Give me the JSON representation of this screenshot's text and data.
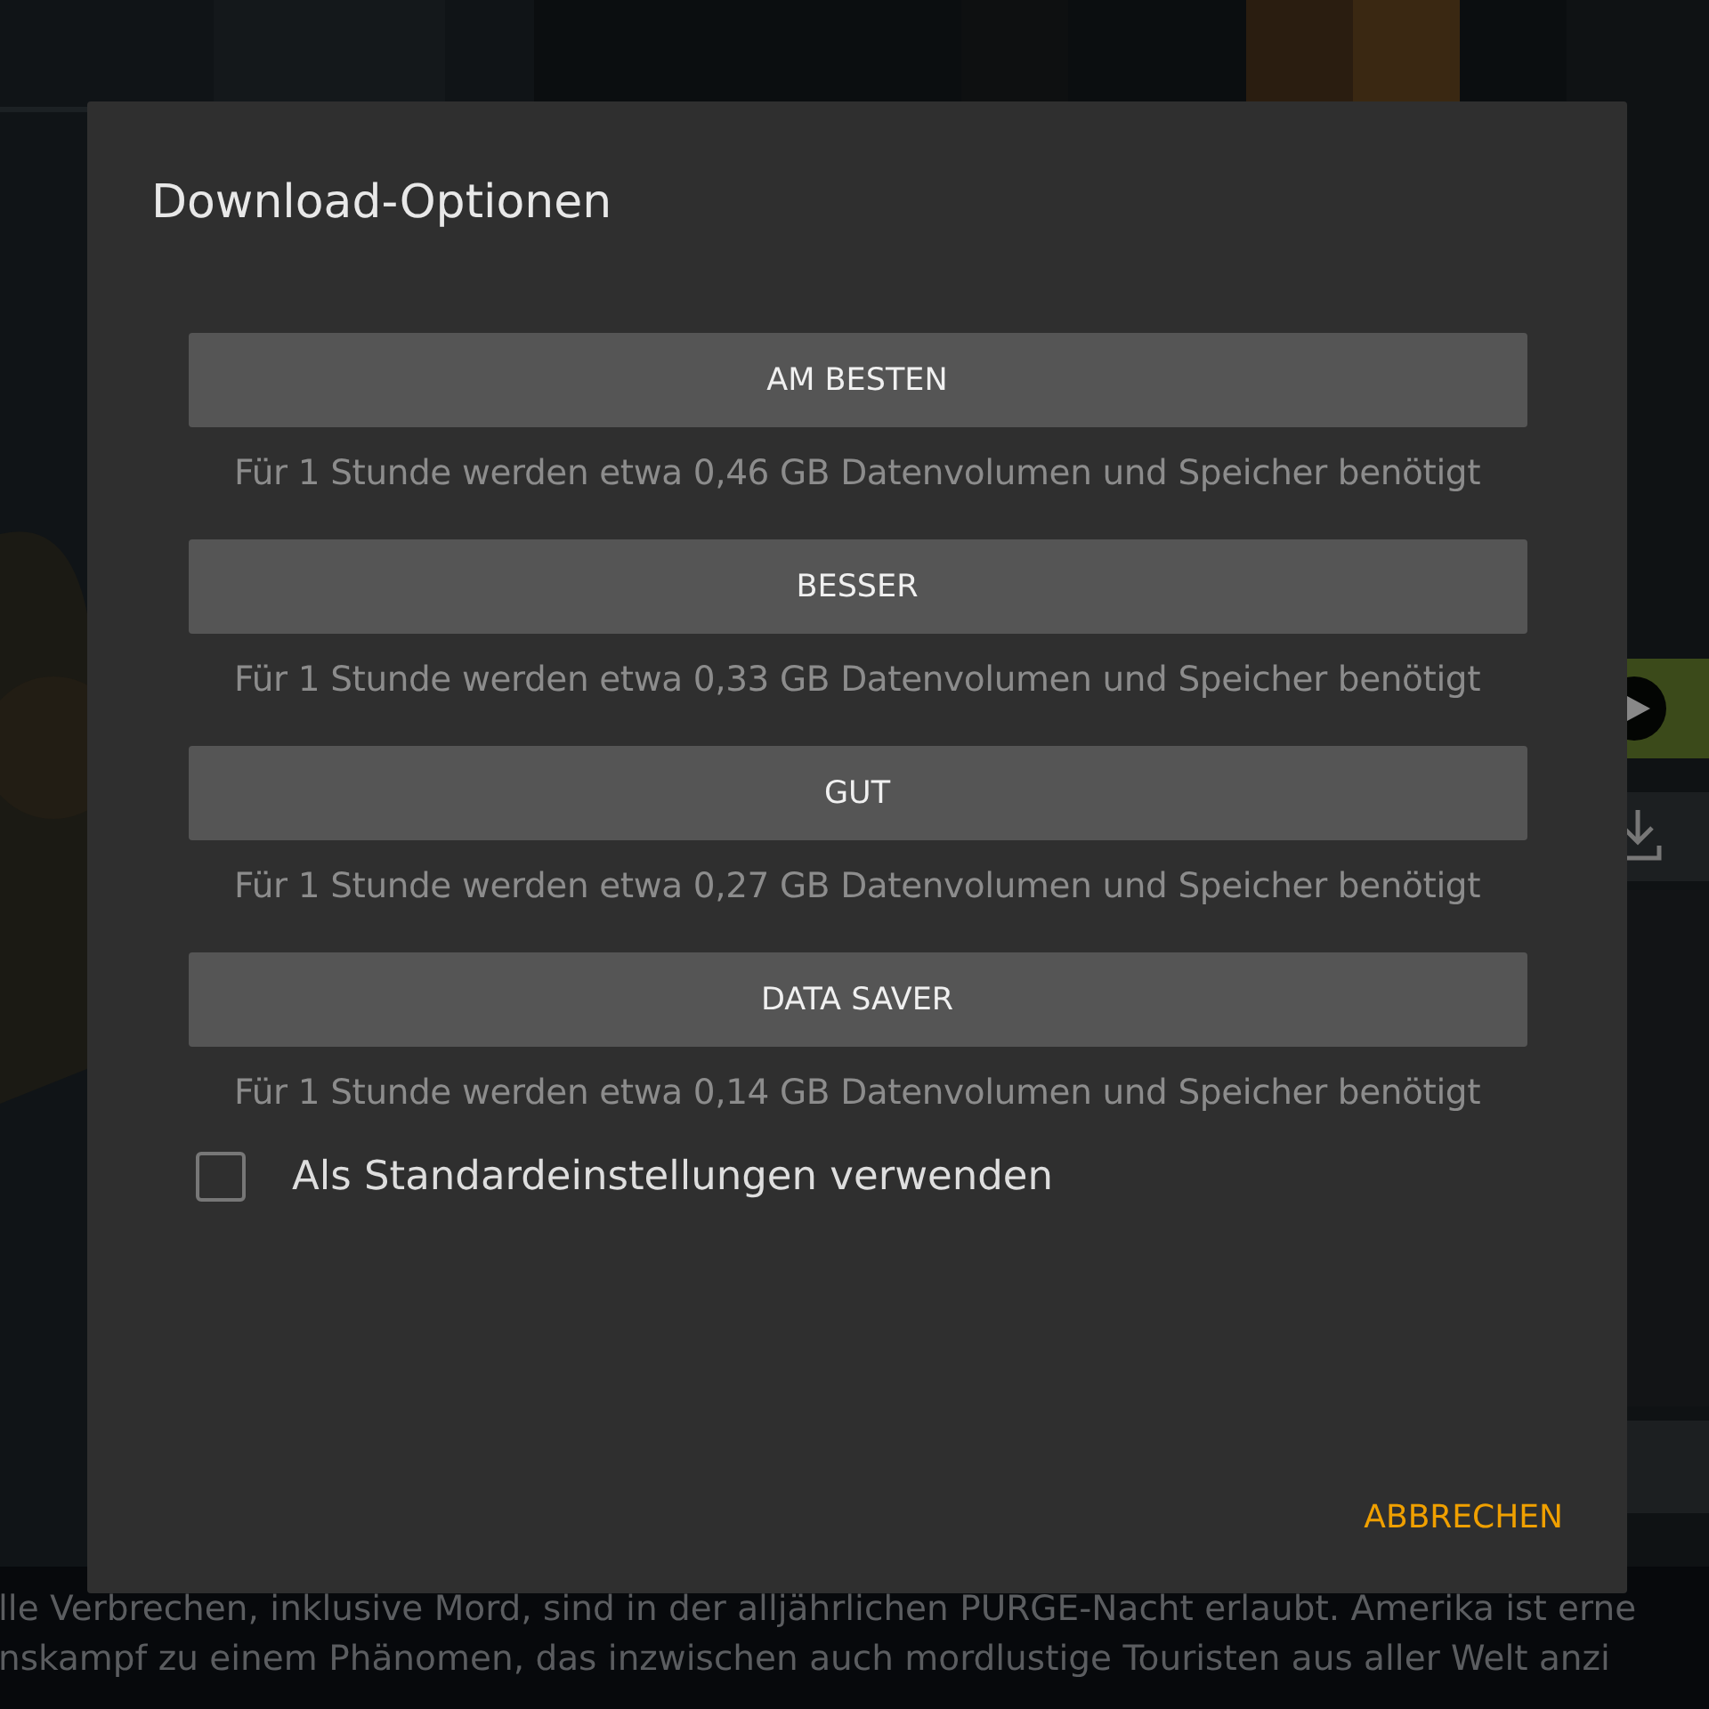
{
  "background": {
    "kind": "picture",
    "description_lines": [
      "lle Verbrechen, inklusive Mord, sind in der alljährlichen PURGE-Nacht erlaubt. Amerika ist erne",
      "nskampf zu einem Phänomen, das inzwischen auch mordlustige Touristen aus aller Welt anzi"
    ]
  },
  "dialog": {
    "title": "Download-Optionen",
    "options": [
      {
        "label": "AM BESTEN",
        "description": "Für 1 Stunde werden etwa 0,46 GB Datenvolumen und Speicher benötigt"
      },
      {
        "label": "BESSER",
        "description": "Für 1 Stunde werden etwa 0,33 GB Datenvolumen und Speicher benötigt"
      },
      {
        "label": "GUT",
        "description": "Für 1 Stunde werden etwa 0,27 GB Datenvolumen und Speicher benötigt"
      },
      {
        "label": "DATA SAVER",
        "description": "Für 1 Stunde werden etwa 0,14 GB Datenvolumen und Speicher benötigt"
      }
    ],
    "default_checkbox": {
      "label": "Als Standardeinstellungen verwenden",
      "checked": false
    },
    "cancel_button": "ABBRECHEN"
  }
}
